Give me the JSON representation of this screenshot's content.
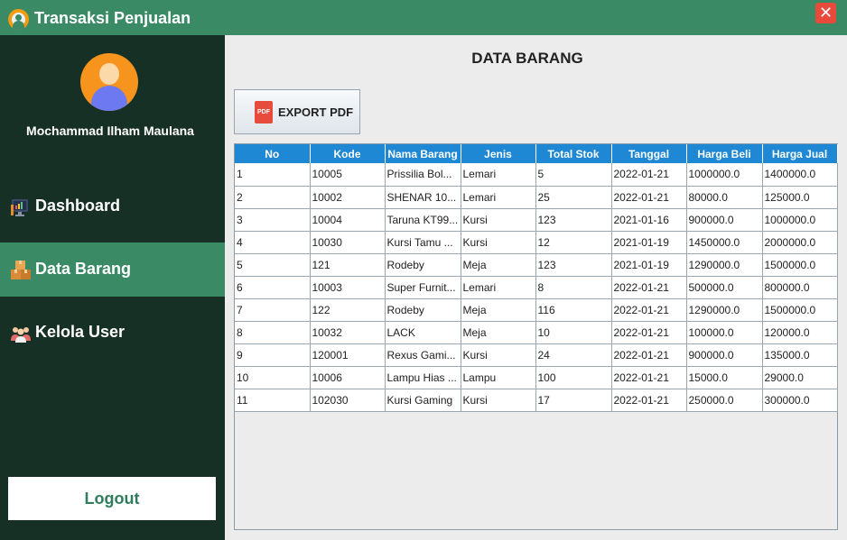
{
  "window": {
    "title": "Transaksi Penjualan",
    "close_symbol": "✕"
  },
  "sidebar": {
    "user_name": "Mochammad Ilham Maulana",
    "items": [
      {
        "label": "Dashboard",
        "icon": "monitor-chart-icon",
        "active": false
      },
      {
        "label": "Data Barang",
        "icon": "boxes-icon",
        "active": true
      },
      {
        "label": "Kelola User",
        "icon": "users-icon",
        "active": false
      }
    ],
    "logout_label": "Logout"
  },
  "main": {
    "title": "DATA BARANG",
    "export_label": "EXPORT PDF",
    "export_icon_text": "PDF"
  },
  "table": {
    "columns": [
      "No",
      "Kode",
      "Nama Barang",
      "Jenis",
      "Total Stok",
      "Tanggal",
      "Harga Beli",
      "Harga Jual"
    ],
    "rows": [
      [
        "1",
        "10005",
        "Prissilia Bol...",
        "Lemari",
        "5",
        "2022-01-21",
        "1000000.0",
        "1400000.0"
      ],
      [
        "2",
        "10002",
        "SHENAR 10...",
        "Lemari",
        "25",
        "2022-01-21",
        "80000.0",
        "125000.0"
      ],
      [
        "3",
        "10004",
        "Taruna KT99...",
        "Kursi",
        "123",
        "2021-01-16",
        "900000.0",
        "1000000.0"
      ],
      [
        "4",
        "10030",
        "Kursi Tamu ...",
        "Kursi",
        "12",
        "2021-01-19",
        "1450000.0",
        "2000000.0"
      ],
      [
        "5",
        "121",
        "Rodeby",
        "Meja",
        "123",
        "2021-01-19",
        "1290000.0",
        "1500000.0"
      ],
      [
        "6",
        "10003",
        "Super Furnit...",
        "Lemari",
        "8",
        "2022-01-21",
        "500000.0",
        "800000.0"
      ],
      [
        "7",
        "122",
        "Rodeby",
        "Meja",
        "116",
        "2022-01-21",
        "1290000.0",
        "1500000.0"
      ],
      [
        "8",
        "10032",
        "LACK",
        "Meja",
        "10",
        "2022-01-21",
        "100000.0",
        "120000.0"
      ],
      [
        "9",
        "120001",
        "Rexus Gami...",
        "Kursi",
        "24",
        "2022-01-21",
        "900000.0",
        "135000.0"
      ],
      [
        "10",
        "10006",
        "Lampu Hias ...",
        "Lampu",
        "100",
        "2022-01-21",
        "15000.0",
        "29000.0"
      ],
      [
        "11",
        "102030",
        "Kursi Gaming",
        "Kursi",
        "17",
        "2022-01-21",
        "250000.0",
        "300000.0"
      ]
    ]
  },
  "colors": {
    "titlebar": "#3a8a66",
    "sidebar": "#163025",
    "active_item": "#3a8a66",
    "table_header": "#1e88d4",
    "close": "#e84b3c"
  }
}
